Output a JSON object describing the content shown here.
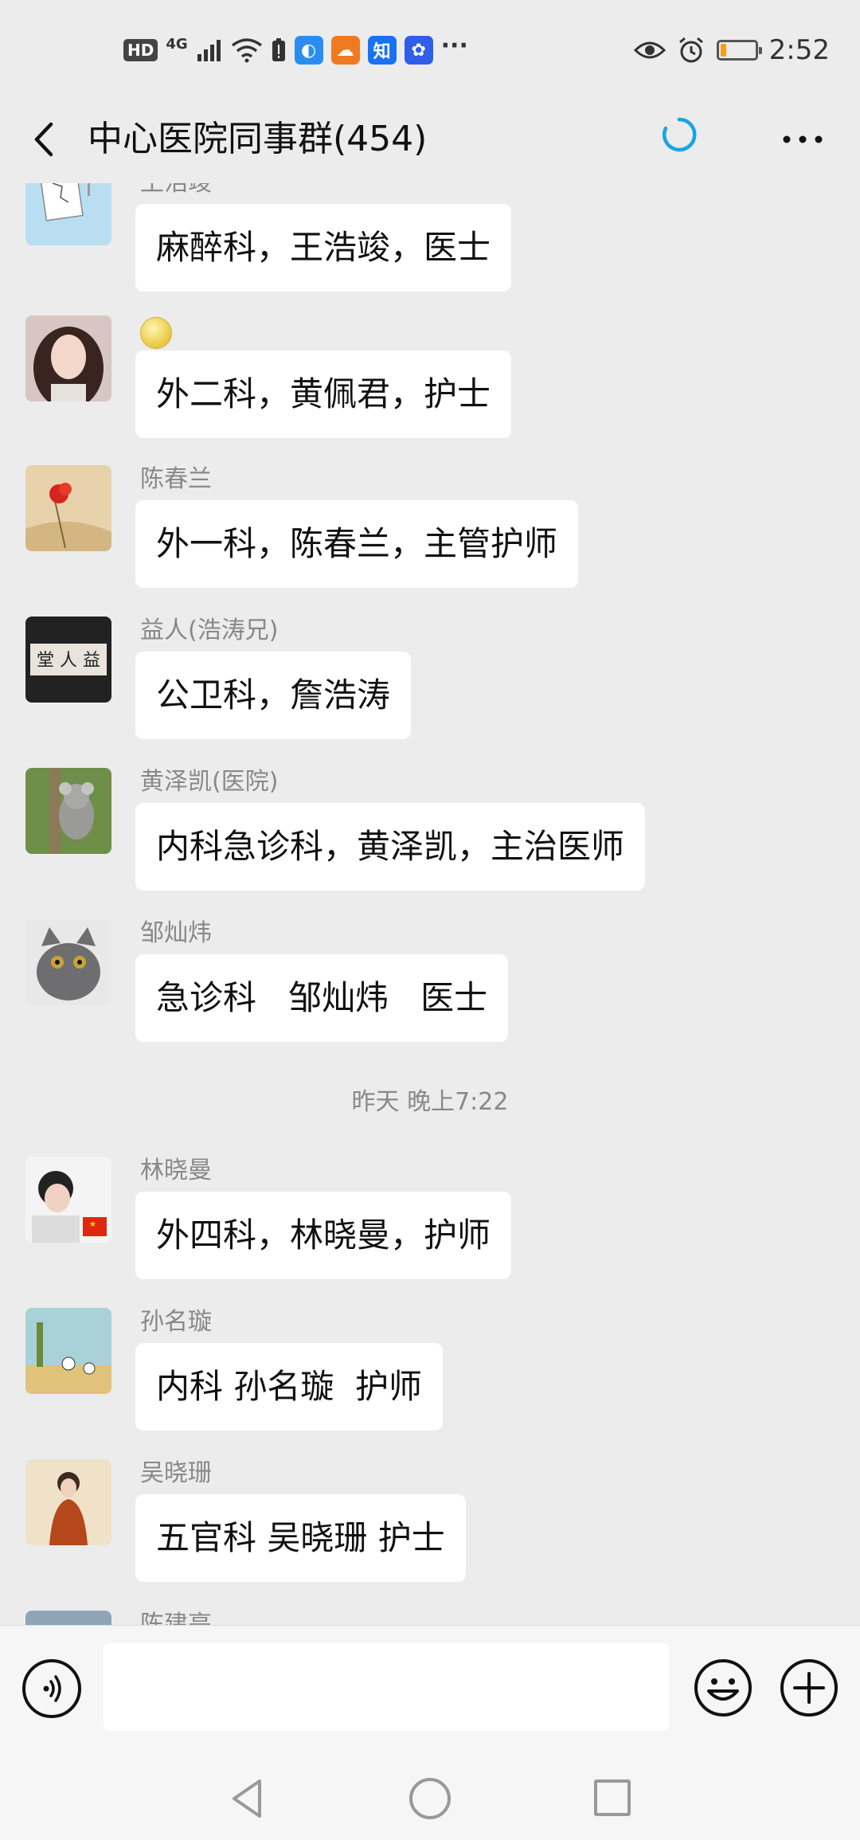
{
  "status_bar": {
    "hd_badge": "HD",
    "network": "4G",
    "app_icons": [
      {
        "name": "qq-browser-icon",
        "glyph": "◐",
        "color": "#2a8ef0"
      },
      {
        "name": "uc-browser-icon",
        "glyph": "☁",
        "color": "#f07a22"
      },
      {
        "name": "zhihu-icon",
        "glyph": "知",
        "color": "#1772f6"
      },
      {
        "name": "baidu-icon",
        "glyph": "✿",
        "color": "#2f5ee8"
      }
    ],
    "overflow": "···",
    "time": "2:52",
    "battery_level": 0.15
  },
  "header": {
    "title": "中心医院同事群(454)"
  },
  "messages": [
    {
      "sender": "王浩竣",
      "text": "麻醉科，王浩竣，医士",
      "avatar": "sketch-avatar"
    },
    {
      "sender": "",
      "sender_emoji": true,
      "text": "外二科，黄佩君，护士",
      "avatar": "girl-avatar"
    },
    {
      "sender": "陈春兰",
      "text": "外一科，陈春兰，主管护师",
      "avatar": "flower-avatar"
    },
    {
      "sender": "益人(浩涛兄)",
      "text": "公卫科，詹浩涛",
      "avatar": "calligraphy-avatar"
    },
    {
      "sender": "黄泽凯(医院)",
      "text": "内科急诊科，黄泽凯，主治医师",
      "avatar": "koala-avatar"
    },
    {
      "sender": "邹灿炜",
      "text": "急诊科   邹灿炜   医士",
      "avatar": "cat-avatar"
    },
    {
      "timestamp": "昨天 晚上7:22"
    },
    {
      "sender": "林晓曼",
      "text": "外四科，林晓曼，护师",
      "avatar": "child-flag-avatar"
    },
    {
      "sender": "孙名璇",
      "text": "内科 孙名璇  护师",
      "avatar": "cartoon-avatar"
    },
    {
      "sender": "吴晓珊",
      "text": "五官科 吴晓珊 护士",
      "avatar": "woman-avatar"
    },
    {
      "sender": "陈建亮",
      "text": "",
      "avatar": "landscape-avatar"
    }
  ],
  "input": {
    "placeholder": ""
  },
  "colors": {
    "background": "#ececec",
    "bubble": "#ffffff",
    "accent": "#1aa3e8"
  }
}
